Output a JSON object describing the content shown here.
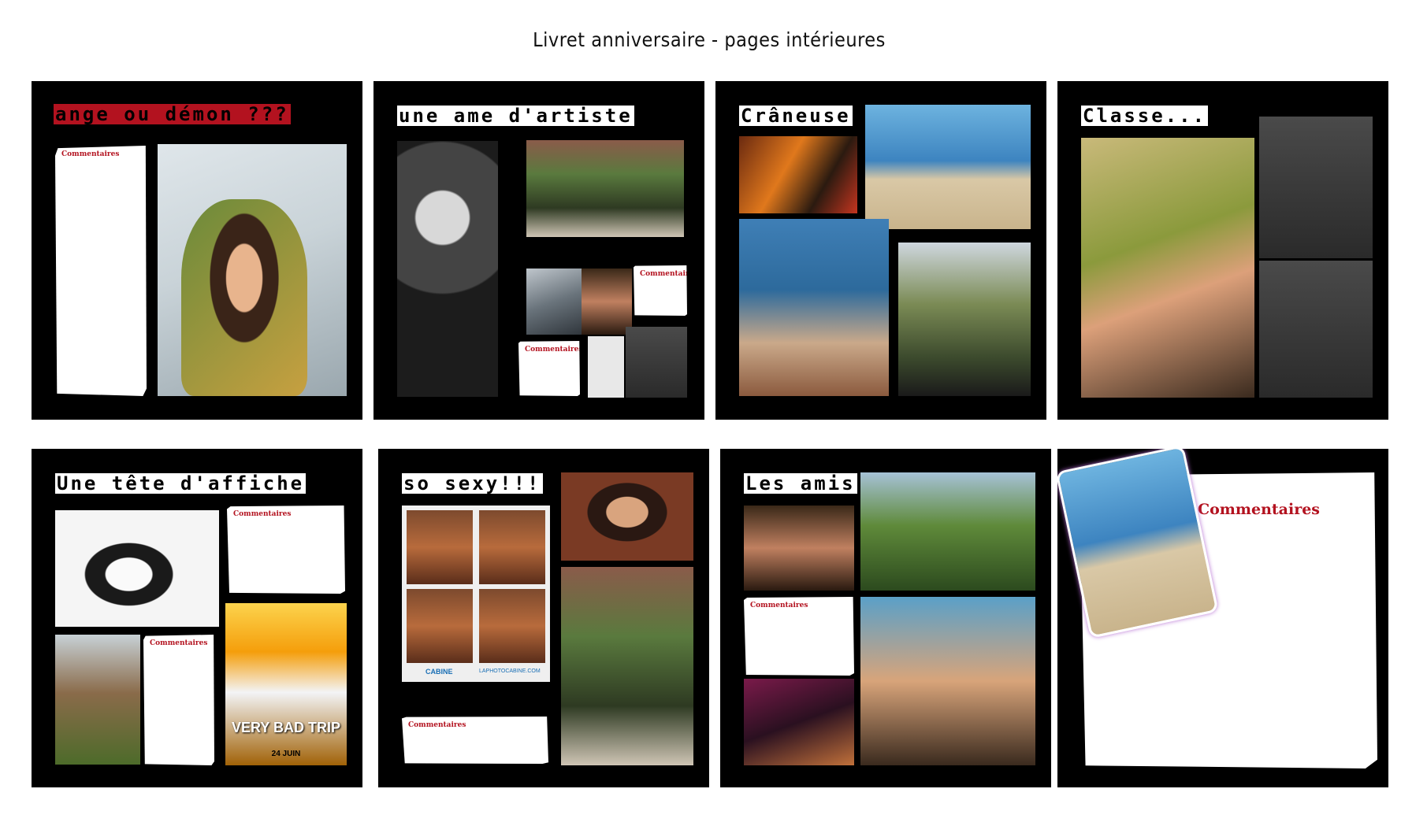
{
  "document": {
    "title": "Livret anniversaire - pages intérieures"
  },
  "pages": [
    {
      "title": "ange ou démon ???",
      "comments": [
        "Commentaires"
      ]
    },
    {
      "title": "une ame d'artiste",
      "comments": [
        "Commentaires",
        "Commentaires"
      ]
    },
    {
      "title": "Crâneuse",
      "comments": []
    },
    {
      "title": "Classe...",
      "comments": []
    },
    {
      "title": "Une tête d'affiche",
      "comments": [
        "Commentaires",
        "Commentaires"
      ],
      "poster": {
        "headline": "VERY BAD TRIP",
        "date": "24 JUIN"
      }
    },
    {
      "title": "so sexy!!!",
      "comments": [
        "Commentaires"
      ],
      "booth": {
        "brand": "CABINE",
        "url": "LAPHOTOCABINE.COM"
      }
    },
    {
      "title": "Les amis",
      "comments": [
        "Commentaires"
      ]
    },
    {
      "title": "",
      "comments": [
        "Commentaires"
      ]
    }
  ],
  "colors": {
    "accent_red": "#b3121f",
    "page_bg": "#000000",
    "card_bg": "#ffffff"
  }
}
